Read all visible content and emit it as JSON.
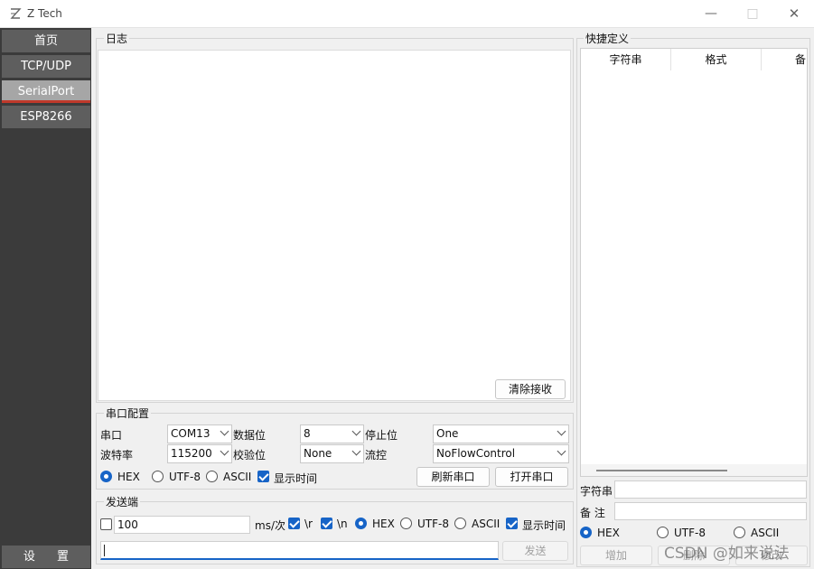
{
  "window": {
    "title": "Z Tech"
  },
  "sidebar": {
    "items": [
      {
        "label": "首页"
      },
      {
        "label": "TCP/UDP"
      },
      {
        "label": "SerialPort"
      },
      {
        "label": "ESP8266"
      }
    ],
    "settings_label": "设 置"
  },
  "log": {
    "title": "日志",
    "clear_button": "清除接收"
  },
  "serial_config": {
    "title": "串口配置",
    "port_label": "串口",
    "port_value": "COM13",
    "databits_label": "数据位",
    "databits_value": "8",
    "stopbits_label": "停止位",
    "stopbits_value": "One",
    "baud_label": "波特率",
    "baud_value": "115200",
    "parity_label": "校验位",
    "parity_value": "None",
    "flow_label": "流控",
    "flow_value": "NoFlowControl",
    "hex_label": "HEX",
    "utf8_label": "UTF-8",
    "ascii_label": "ASCII",
    "show_time_label": "显示时间",
    "refresh_button": "刷新串口",
    "open_button": "打开串口"
  },
  "send": {
    "title": "发送端",
    "interval_value": "100",
    "interval_unit": "ms/次",
    "cr_label": "\\r",
    "lf_label": "\\n",
    "hex_label": "HEX",
    "utf8_label": "UTF-8",
    "ascii_label": "ASCII",
    "show_time_label": "显示时间",
    "input_value": "",
    "send_button": "发送"
  },
  "quick": {
    "title": "快捷定义",
    "columns": [
      "字符串",
      "格式",
      "备"
    ],
    "string_label": "字符串",
    "note_label": "备 注",
    "hex_label": "HEX",
    "utf8_label": "UTF-8",
    "ascii_label": "ASCII",
    "add_button": "增加",
    "delete_button": "删除",
    "modify_button": "修改"
  },
  "watermark": "CSDN @如来说法",
  "colors": {
    "sidebar_bg": "#3b3b3b",
    "nav_item": "#5e5e5e",
    "nav_active": "#a6a6a6",
    "active_underline": "#c0392b",
    "accent": "#1764c7"
  }
}
